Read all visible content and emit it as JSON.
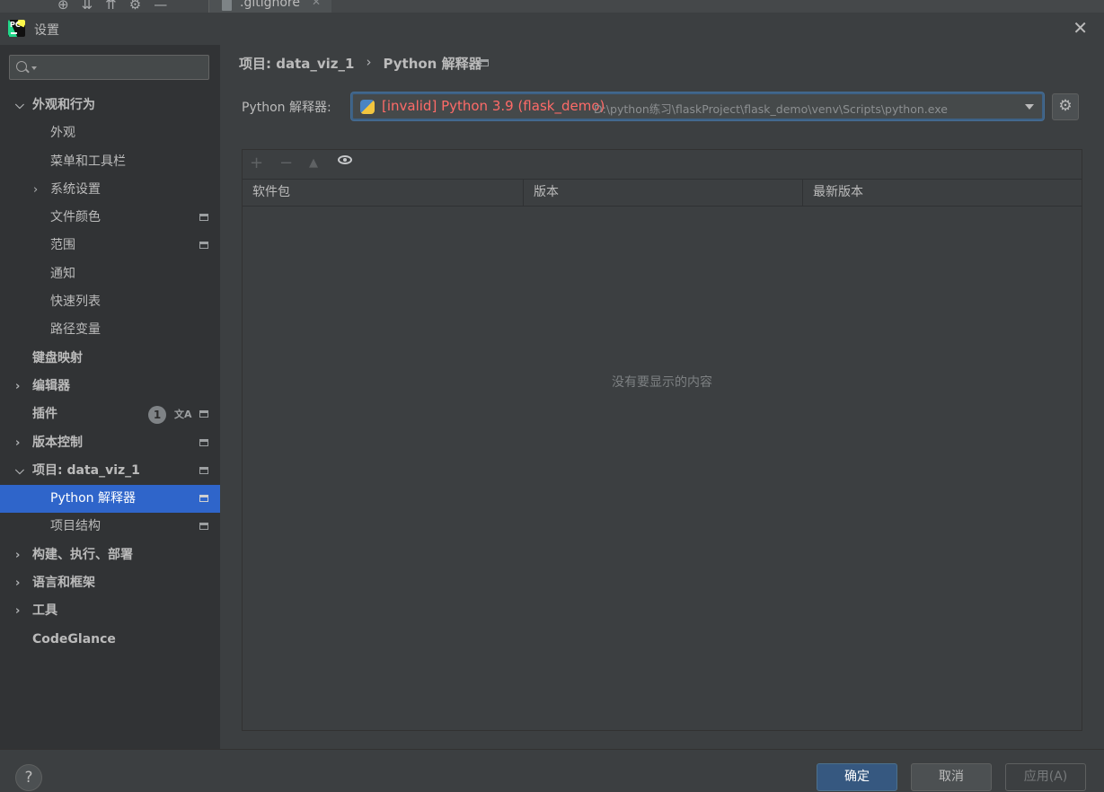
{
  "ide_strip": {
    "tab_label": ".gitignore"
  },
  "dialog": {
    "title": "设置",
    "close_glyph": "✕"
  },
  "search": {
    "placeholder": ""
  },
  "tree": [
    {
      "label": "外观和行为",
      "bold": true,
      "expanded": true,
      "level": 0,
      "has_chevron": true,
      "chev": "⌵"
    },
    {
      "label": "外观",
      "level": 1
    },
    {
      "label": "菜单和工具栏",
      "level": 1
    },
    {
      "label": "系统设置",
      "level": 1,
      "has_chevron": true,
      "chev": "›"
    },
    {
      "label": "文件颜色",
      "level": 1,
      "project_icon": true
    },
    {
      "label": "范围",
      "level": 1,
      "project_icon": true
    },
    {
      "label": "通知",
      "level": 1
    },
    {
      "label": "快速列表",
      "level": 1
    },
    {
      "label": "路径变量",
      "level": 1
    },
    {
      "label": "键盘映射",
      "bold": true,
      "level": 0
    },
    {
      "label": "编辑器",
      "bold": true,
      "level": 0,
      "has_chevron": true,
      "chev": "›"
    },
    {
      "label": "插件",
      "bold": true,
      "level": 0,
      "badge": "1",
      "translate_icon": true,
      "project_icon": true
    },
    {
      "label": "版本控制",
      "bold": true,
      "level": 0,
      "has_chevron": true,
      "chev": "›",
      "project_icon": true
    },
    {
      "label": "项目: data_viz_1",
      "bold": true,
      "level": 0,
      "has_chevron": true,
      "chev": "⌵",
      "project_icon": true
    },
    {
      "label": "Python 解释器",
      "level": 1,
      "selected": true,
      "project_icon": true
    },
    {
      "label": "项目结构",
      "level": 1,
      "project_icon": true
    },
    {
      "label": "构建、执行、部署",
      "bold": true,
      "level": 0,
      "has_chevron": true,
      "chev": "›"
    },
    {
      "label": "语言和框架",
      "bold": true,
      "level": 0,
      "has_chevron": true,
      "chev": "›"
    },
    {
      "label": "工具",
      "bold": true,
      "level": 0,
      "has_chevron": true,
      "chev": "›"
    },
    {
      "label": "CodeGlance",
      "bold": true,
      "level": 0
    }
  ],
  "breadcrumb": {
    "project": "项目: data_viz_1",
    "separator": "›",
    "page": "Python 解释器"
  },
  "interpreter": {
    "label": "Python 解释器:",
    "invalid_name": "[invalid] Python 3.9 (flask_demo)",
    "path": "D:\\python练习\\flaskProject\\flask_demo\\venv\\Scripts\\python.exe"
  },
  "toolbar": {
    "add": "+",
    "remove": "−",
    "up": "▲"
  },
  "packages": {
    "columns": [
      "软件包",
      "版本",
      "最新版本"
    ],
    "empty_text": "没有要显示的内容"
  },
  "footer": {
    "help": "?",
    "ok": "确定",
    "cancel": "取消",
    "apply": "应用(A)"
  },
  "colors": {
    "selected": "#2f65ca",
    "invalid": "#ff6b68",
    "primary_button": "#365880"
  }
}
